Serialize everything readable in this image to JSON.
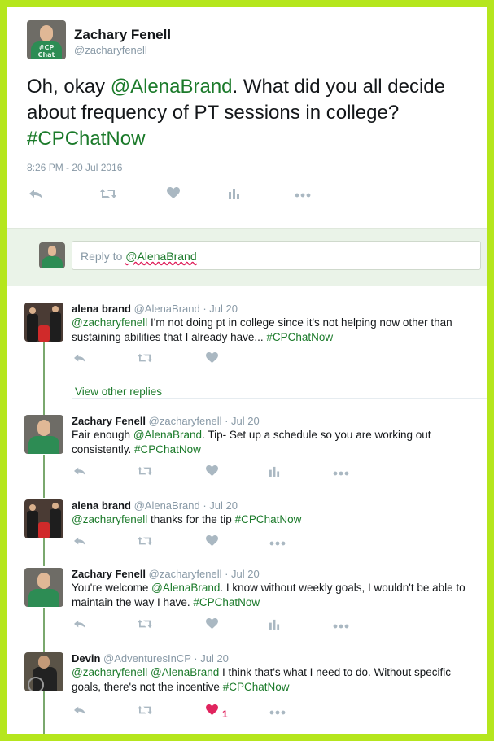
{
  "main_tweet": {
    "name": "Zachary Fenell",
    "handle": "@zacharyfenell",
    "text_a": "Oh, okay ",
    "mention": "@AlenaBrand",
    "text_b": ". What did you all decide about frequency of PT sessions in college? ",
    "hashtag": "#CPChatNow",
    "timestamp": "8:26 PM - 20 Jul 2016",
    "avatar_shirt": "#CP Chat Now"
  },
  "reply": {
    "prefix": "Reply to ",
    "mention": "@AlenaBrand"
  },
  "replies": [
    {
      "name": "alena brand",
      "meta": "@AlenaBrand · Jul 20",
      "parts": [
        "@zacharyfenell",
        " I'm not doing pt in college since it's not helping now other than sustaining abilities that I already have... ",
        "#CPChatNow"
      ],
      "view_more": "View other replies"
    },
    {
      "name": "Zachary Fenell",
      "meta": "@zacharyfenell · Jul 20",
      "parts": [
        "Fair enough ",
        "@AlenaBrand",
        ". Tip- Set up a schedule so you are working out consistently. ",
        "#CPChatNow"
      ]
    },
    {
      "name": "alena brand",
      "meta": "@AlenaBrand · Jul 20",
      "parts": [
        "@zacharyfenell",
        " thanks for the tip ",
        "#CPChatNow"
      ]
    },
    {
      "name": "Zachary Fenell",
      "meta": "@zacharyfenell · Jul 20",
      "parts": [
        "You're welcome ",
        "@AlenaBrand",
        ". I know without weekly goals, I wouldn't be able to maintain the way I have. ",
        "#CPChatNow"
      ]
    },
    {
      "name": "Devin",
      "meta": "@AdventuresInCP · Jul 20",
      "parts": [
        "@zacharyfenell",
        " ",
        "@AlenaBrand",
        " I think that's what I need to do. Without specific goals, there's not the incentive ",
        "#CPChatNow"
      ],
      "like_count": "1"
    }
  ],
  "colors": {
    "border": "#b5e61d",
    "link": "#1b7a2a",
    "icon": "#aab8c2",
    "liked": "#e0245e"
  }
}
